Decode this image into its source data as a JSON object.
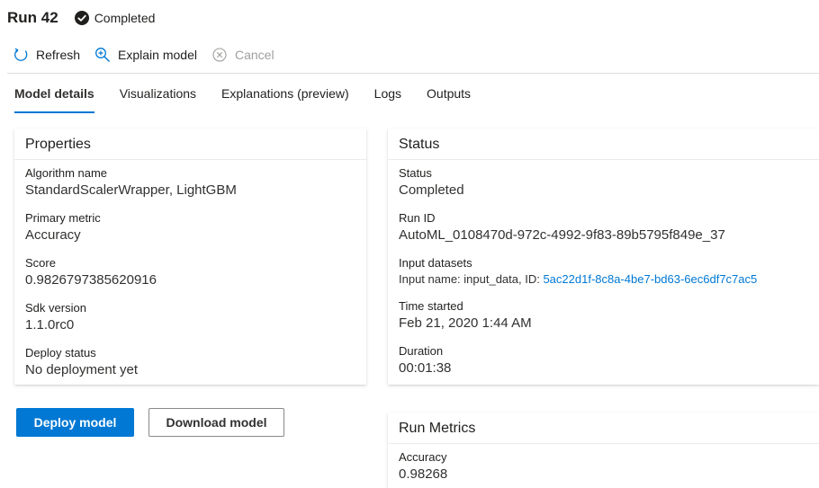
{
  "header": {
    "title": "Run 42",
    "status": "Completed"
  },
  "toolbar": {
    "refresh": "Refresh",
    "explain": "Explain model",
    "cancel": "Cancel"
  },
  "tabs": [
    {
      "label": "Model details",
      "active": true
    },
    {
      "label": "Visualizations",
      "active": false
    },
    {
      "label": "Explanations (preview)",
      "active": false
    },
    {
      "label": "Logs",
      "active": false
    },
    {
      "label": "Outputs",
      "active": false
    }
  ],
  "properties": {
    "title": "Properties",
    "fields": [
      {
        "label": "Algorithm name",
        "value": "StandardScalerWrapper, LightGBM"
      },
      {
        "label": "Primary metric",
        "value": "Accuracy"
      },
      {
        "label": "Score",
        "value": "0.9826797385620916"
      },
      {
        "label": "Sdk version",
        "value": "1.1.0rc0"
      },
      {
        "label": "Deploy status",
        "value": "No deployment yet"
      }
    ]
  },
  "status": {
    "title": "Status",
    "status_label": "Status",
    "status_value": "Completed",
    "runid_label": "Run ID",
    "runid_value": "AutoML_0108470d-972c-4992-9f83-89b5795f849e_37",
    "datasets_label": "Input datasets",
    "datasets_prefix": "Input name: input_data, ID:",
    "datasets_id": "5ac22d1f-8c8a-4be7-bd63-6ec6df7c7ac5",
    "started_label": "Time started",
    "started_value": "Feb 21, 2020 1:44 AM",
    "duration_label": "Duration",
    "duration_value": "00:01:38"
  },
  "actions": {
    "deploy": "Deploy model",
    "download": "Download model"
  },
  "metrics": {
    "title": "Run Metrics",
    "label": "Accuracy",
    "value": "0.98268"
  },
  "colors": {
    "accent": "#0078d4",
    "text": "#201f1e",
    "disabled": "#a19f9d"
  }
}
